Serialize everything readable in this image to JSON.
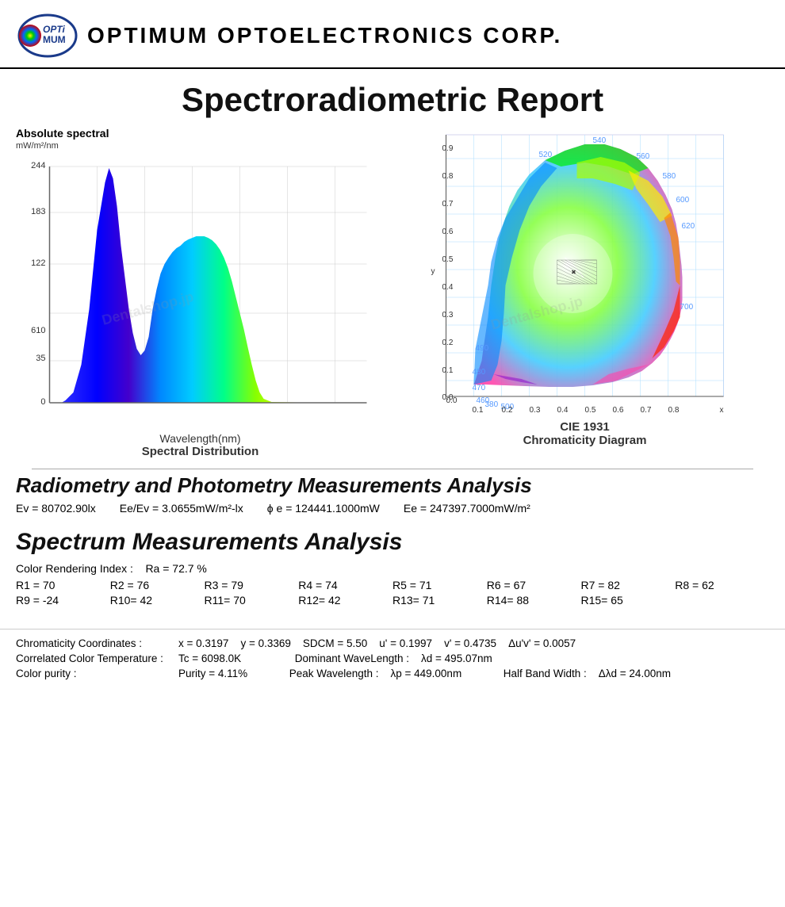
{
  "header": {
    "company": "OPTIMUM  OPTOELECTRONICS  CORP.",
    "logo_alt": "Optimum Logo"
  },
  "title": "Spectroradiometric Report",
  "spectral_chart": {
    "label": "Absolute spectral",
    "unit": "mW/m²/nm",
    "y_ticks": [
      "244",
      "183",
      "122",
      "610",
      "35",
      "0"
    ],
    "x_label": "Wavelength(nm)",
    "sub_title": "Spectral Distribution"
  },
  "cie_chart": {
    "title": "CIE 1931",
    "sub_title": "Chromaticity Diagram"
  },
  "radiometry": {
    "title": "Radiometry and Photometry Measurements Analysis",
    "ev": "Ev = 80702.90lx",
    "ee_ev": "Ee/Ev = 3.0655mW/m²-lx",
    "phi_e": "ϕ e = 124441.1000mW",
    "ee": "Ee = 247397.7000mW/m²"
  },
  "spectrum": {
    "title": "Spectrum Measurements Analysis",
    "cri_label": "Color Rendering Index :",
    "cri_value": "Ra = 72.7 %",
    "r_rows": [
      [
        "R1 = 70",
        "R2 = 76",
        "R3 = 79",
        "R4 = 74",
        "R5 = 71",
        "R6 = 67",
        "R7 = 82",
        "R8 = 62"
      ],
      [
        "R9 = -24",
        "R10= 42",
        "R11= 70",
        "R12= 42",
        "R13= 71",
        "R14= 88",
        "R15= 65",
        ""
      ]
    ]
  },
  "chromaticity": {
    "row1_label": "Chromaticity Coordinates :",
    "row1_values": [
      {
        "key": "x =",
        "val": "0.3197"
      },
      {
        "key": "y =",
        "val": "0.3369"
      },
      {
        "key": "SDCM =",
        "val": "5.50"
      },
      {
        "key": "u' =",
        "val": "0.1997"
      },
      {
        "key": "v' =",
        "val": "0.4735"
      },
      {
        "key": "Δu'v' =",
        "val": "0.0057"
      }
    ],
    "row2_label": "Correlated Color Temperature :",
    "row2_tc": "Tc = 6098.0K",
    "row2_dom_label": "Dominant WaveLength :",
    "row2_dom": "λd = 495.07nm",
    "row3_label": "Color purity :",
    "row3_purity": "Purity = 4.11%",
    "row3_peak_label": "Peak Wavelength :",
    "row3_peak": "λp = 449.00nm",
    "row3_hbw_label": "Half Band Width :",
    "row3_hbw": "Δλd = 24.00nm"
  }
}
